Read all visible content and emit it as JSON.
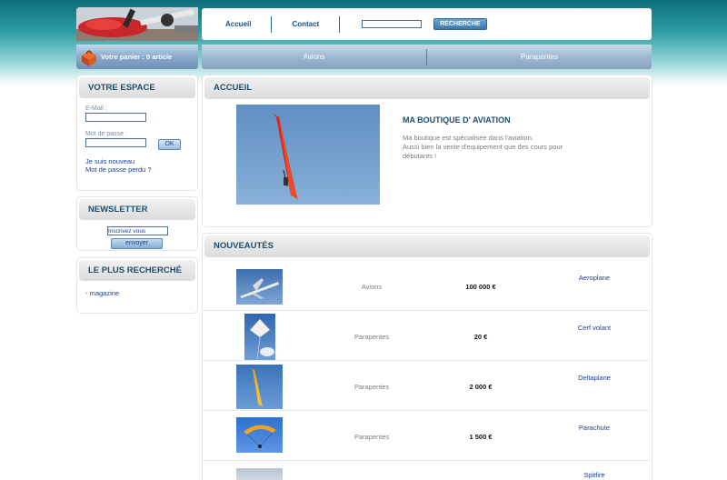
{
  "header": {
    "nav": [
      {
        "label": "Accueil"
      },
      {
        "label": "Contact"
      }
    ],
    "search": {
      "value": "",
      "button_label": "RECHERCHE"
    }
  },
  "cart": {
    "text": "Votre panier : 0 article"
  },
  "categories": [
    {
      "label": "Avions"
    },
    {
      "label": "Parapentes"
    }
  ],
  "sidebar": {
    "account": {
      "title": "VOTRE ESPACE",
      "email_label": "E-Mail :",
      "password_label": "Mot de passe :",
      "ok_label": "OK",
      "register_link": "Je suis nouveau",
      "forgot_link": "Mot de passe perdu ?"
    },
    "newsletter": {
      "title": "NEWSLETTER",
      "input_value": "Inscrivez vous",
      "button_label": "envoyer"
    },
    "popular": {
      "title": "LE PLUS RECHERCHÉ",
      "items": [
        {
          "label": "- magazine"
        }
      ]
    }
  },
  "main": {
    "welcome": {
      "title": "ACCUEIL",
      "shop_title": "MA BOUTIQUE D' AVIATION",
      "desc_line1": "Ma boutique est spécialisée dans l'aviation.",
      "desc_line2": "Aussi bien la vente d'equipement que des cours pour",
      "desc_line3": "débutants !"
    },
    "new_products": {
      "title": "NOUVEAUTÉS",
      "rows": [
        {
          "category": "Avions",
          "price": "100 000 €",
          "name": "Aeroplane"
        },
        {
          "category": "Parapentes",
          "price": "20 €",
          "name": "Cerf volant"
        },
        {
          "category": "Parapentes",
          "price": "2 000 €",
          "name": "Deltaplane"
        },
        {
          "category": "Parapentes",
          "price": "1 500 €",
          "name": "Parachute"
        },
        {
          "category": "",
          "price": "",
          "name": "Spitfire"
        }
      ]
    }
  },
  "colors": {
    "accent": "#1e4e6c",
    "link": "#1f3f8c",
    "teal_header": "#0d6e78"
  }
}
